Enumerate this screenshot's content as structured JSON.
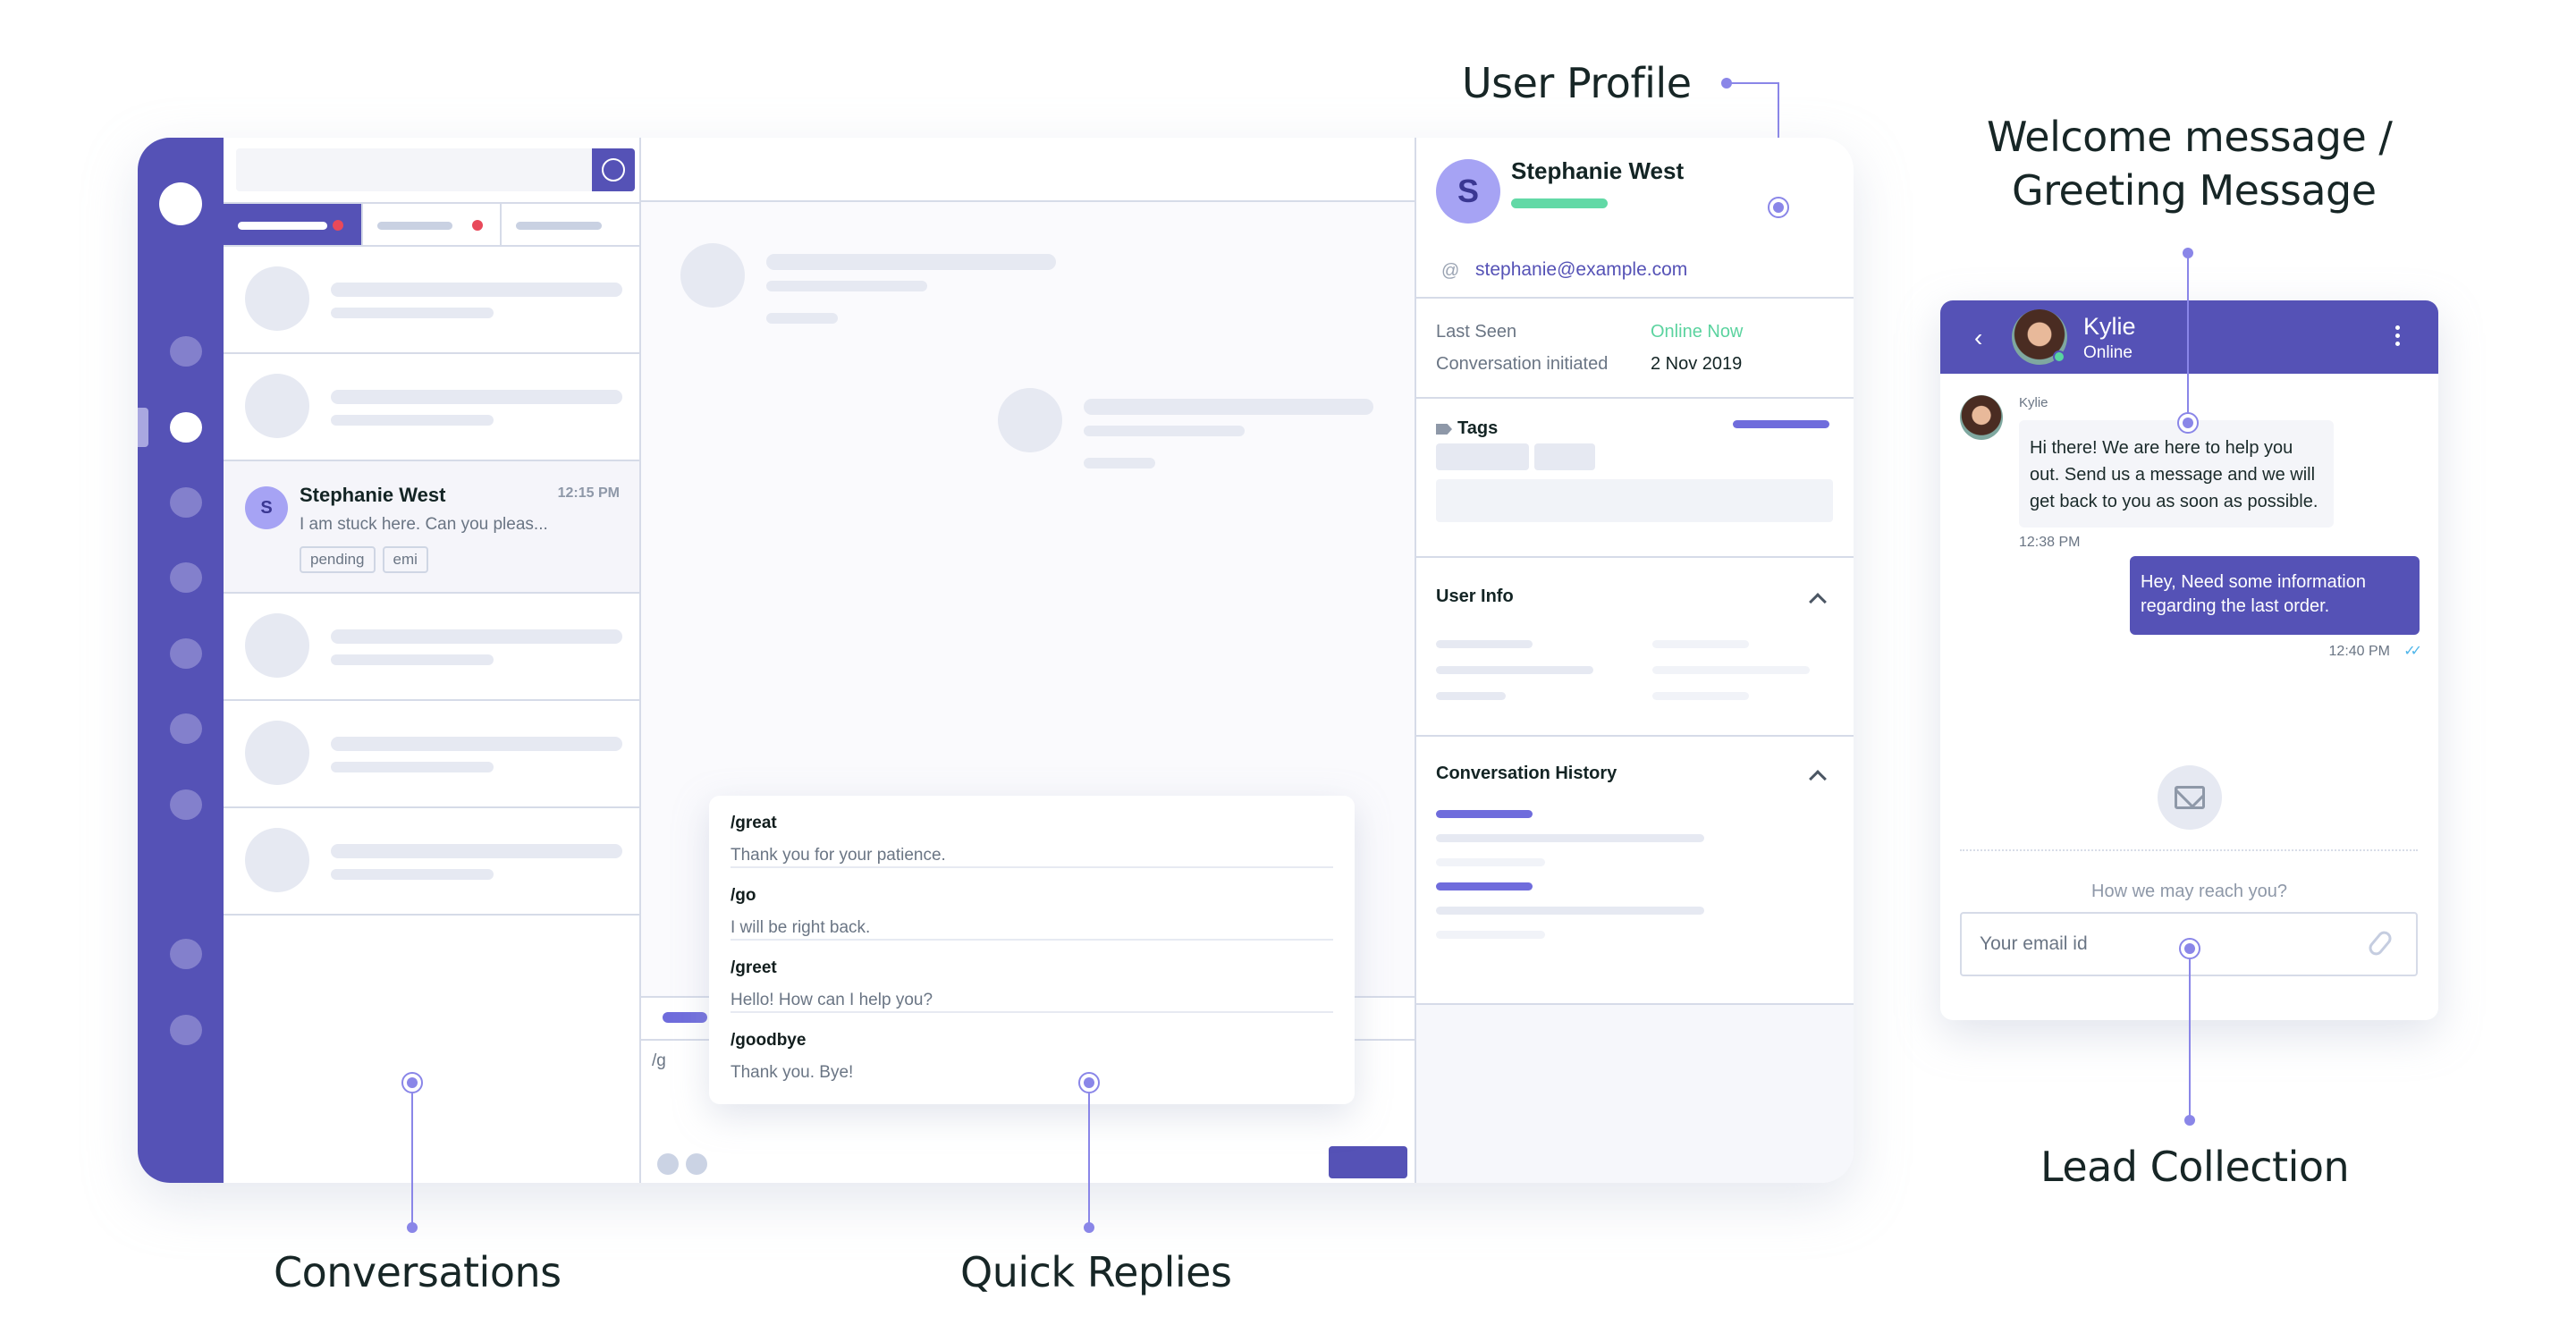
{
  "annotations": {
    "user_profile": "User Profile",
    "welcome_line1": "Welcome message /",
    "welcome_line2": "Greeting Message",
    "lead_collection": "Lead Collection",
    "conversations": "Conversations",
    "quick_replies": "Quick Replies"
  },
  "colors": {
    "brand": "#5552b6",
    "accent_light": "#a6a3f4",
    "online": "#62d9a6",
    "badge_red": "#e8495a",
    "annotation": "#8a86e8"
  },
  "conversation_list": {
    "search_icon": "search-icon",
    "selected": {
      "initial": "S",
      "name": "Stephanie West",
      "time": "12:15 PM",
      "preview": "I am stuck here. Can you pleas...",
      "tags": [
        "pending",
        "emi"
      ]
    }
  },
  "composer": {
    "text": "/g"
  },
  "quick_replies": [
    {
      "command": "/great",
      "text": "Thank you for your patience."
    },
    {
      "command": "/go",
      "text": "I will be right back."
    },
    {
      "command": "/greet",
      "text": "Hello! How can I help you?"
    },
    {
      "command": "/goodbye",
      "text": "Thank you. Bye!"
    }
  ],
  "profile": {
    "initial": "S",
    "name": "Stephanie West",
    "at_symbol": "@",
    "email": "stephanie@example.com",
    "last_seen_label": "Last Seen",
    "last_seen_value": "Online Now",
    "initiated_label": "Conversation initiated",
    "initiated_value": "2 Nov 2019",
    "tags_label": "Tags",
    "user_info_label": "User Info",
    "history_label": "Conversation History"
  },
  "widget": {
    "back": "‹",
    "name": "Kylie",
    "status": "Online",
    "sender": "Kylie",
    "welcome_message": "Hi there! We are here to help you out. Send us a message and we will get back to you as soon as possible.",
    "welcome_time": "12:38 PM",
    "user_message": "Hey, Need some information regarding the last order.",
    "user_time": "12:40 PM",
    "read_ticks": "✓✓",
    "reach_prompt": "How we may reach you?",
    "email_placeholder": "Your email id"
  }
}
